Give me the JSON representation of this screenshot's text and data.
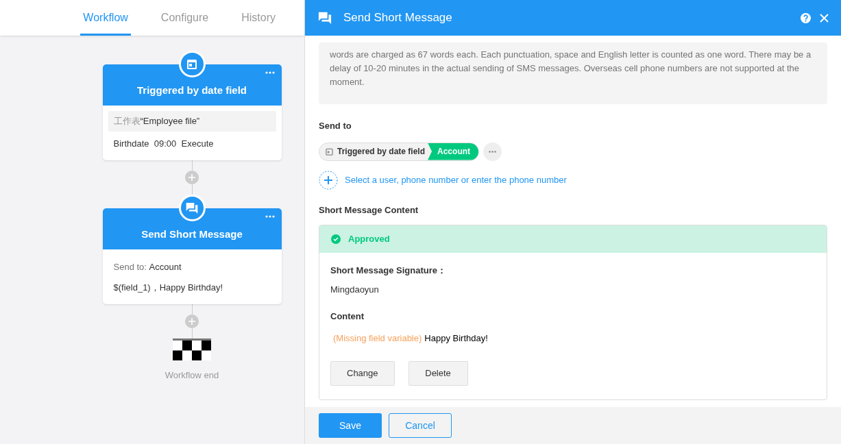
{
  "tabs": [
    {
      "label": "Workflow",
      "selected": true
    },
    {
      "label": "Configure",
      "selected": false
    },
    {
      "label": "History",
      "selected": false
    }
  ],
  "nodes": [
    {
      "kind": "trigger",
      "title": "Triggered by date field",
      "lines": [
        {
          "kind": "source",
          "prefix": "工作表",
          "text": "“Employee file”"
        },
        {
          "kind": "plain",
          "text": "Birthdate  09:00  Execute"
        }
      ]
    },
    {
      "kind": "message",
      "title": "Send Short Message",
      "lines": [
        {
          "kind": "labeled",
          "prefix": "Send to: ",
          "text": "Account"
        },
        {
          "kind": "plain",
          "text": "$(field_1)，Happy Birthday!"
        }
      ]
    }
  ],
  "end_label": "Workflow end",
  "panel": {
    "title": "Send Short Message",
    "notice": "words are charged as 67 words each. Each punctuation, space and English letter is counted as one word. There may be a delay of 10-20 minutes in the actual sending of SMS messages. Overseas cell phone numbers are not supported at the moment.",
    "send_to_label": "Send to",
    "recipient": {
      "source": "Triggered by date field",
      "field": "Account"
    },
    "add_recipient": "Select a user, phone number or enter the phone number",
    "content_label": "Short Message Content",
    "status": "Approved",
    "signature_label": "Short Message Signature：",
    "signature": "Mingdaoyun",
    "content_heading": "Content",
    "content": {
      "missing": "(Missing field variable)",
      "text": "Happy Birthday!"
    },
    "actions": [
      "Change",
      "Delete"
    ],
    "footer": {
      "save": "Save",
      "cancel": "Cancel"
    }
  }
}
